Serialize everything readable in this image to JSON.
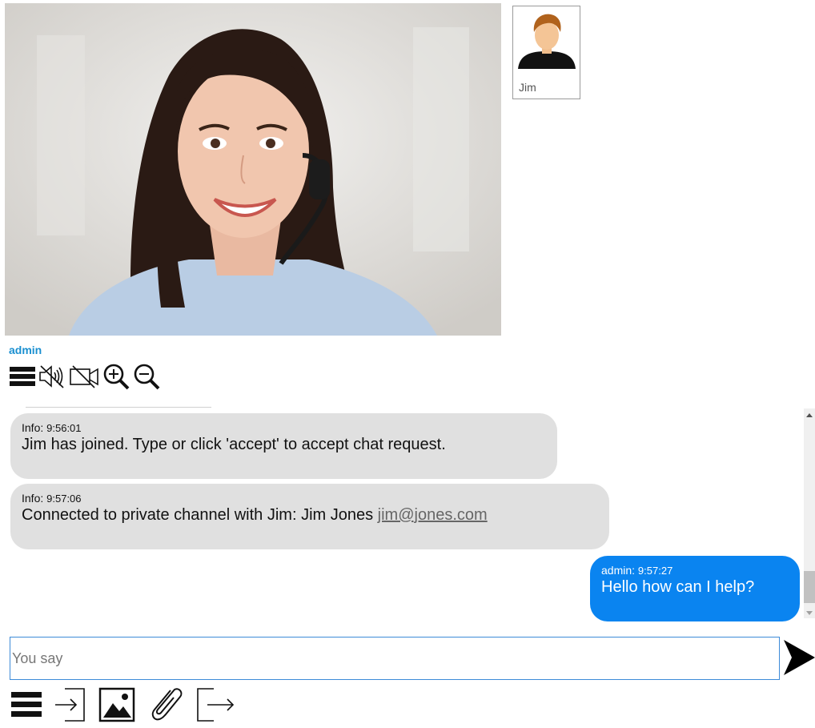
{
  "remote_participant": {
    "name": "Jim"
  },
  "local_participant": {
    "name": "admin"
  },
  "media_controls": [
    {
      "icon": "menu-icon"
    },
    {
      "icon": "speaker-muted-icon"
    },
    {
      "icon": "camera-off-icon"
    },
    {
      "icon": "zoom-in-icon"
    },
    {
      "icon": "zoom-out-icon"
    }
  ],
  "messages": [
    {
      "sender": "Info:",
      "time": "9:56:01",
      "text": "Jim has joined. Type or click 'accept' to accept chat request."
    },
    {
      "sender": "Info:",
      "time": "9:57:06",
      "text": "Connected to private channel with Jim: Jim Jones ",
      "link": "jim@jones.com"
    },
    {
      "sender": "admin:",
      "time": "9:57:27",
      "text": "Hello how can I help?"
    }
  ],
  "input": {
    "placeholder": "You say",
    "value": ""
  },
  "bottom_tools": [
    {
      "icon": "menu-icon"
    },
    {
      "icon": "login-icon"
    },
    {
      "icon": "image-icon"
    },
    {
      "icon": "paperclip-icon"
    },
    {
      "icon": "logout-icon"
    }
  ],
  "colors": {
    "accent": "#0a84f0",
    "owner_name": "#1a8fd0",
    "info_bubble": "#e0e0e0"
  }
}
